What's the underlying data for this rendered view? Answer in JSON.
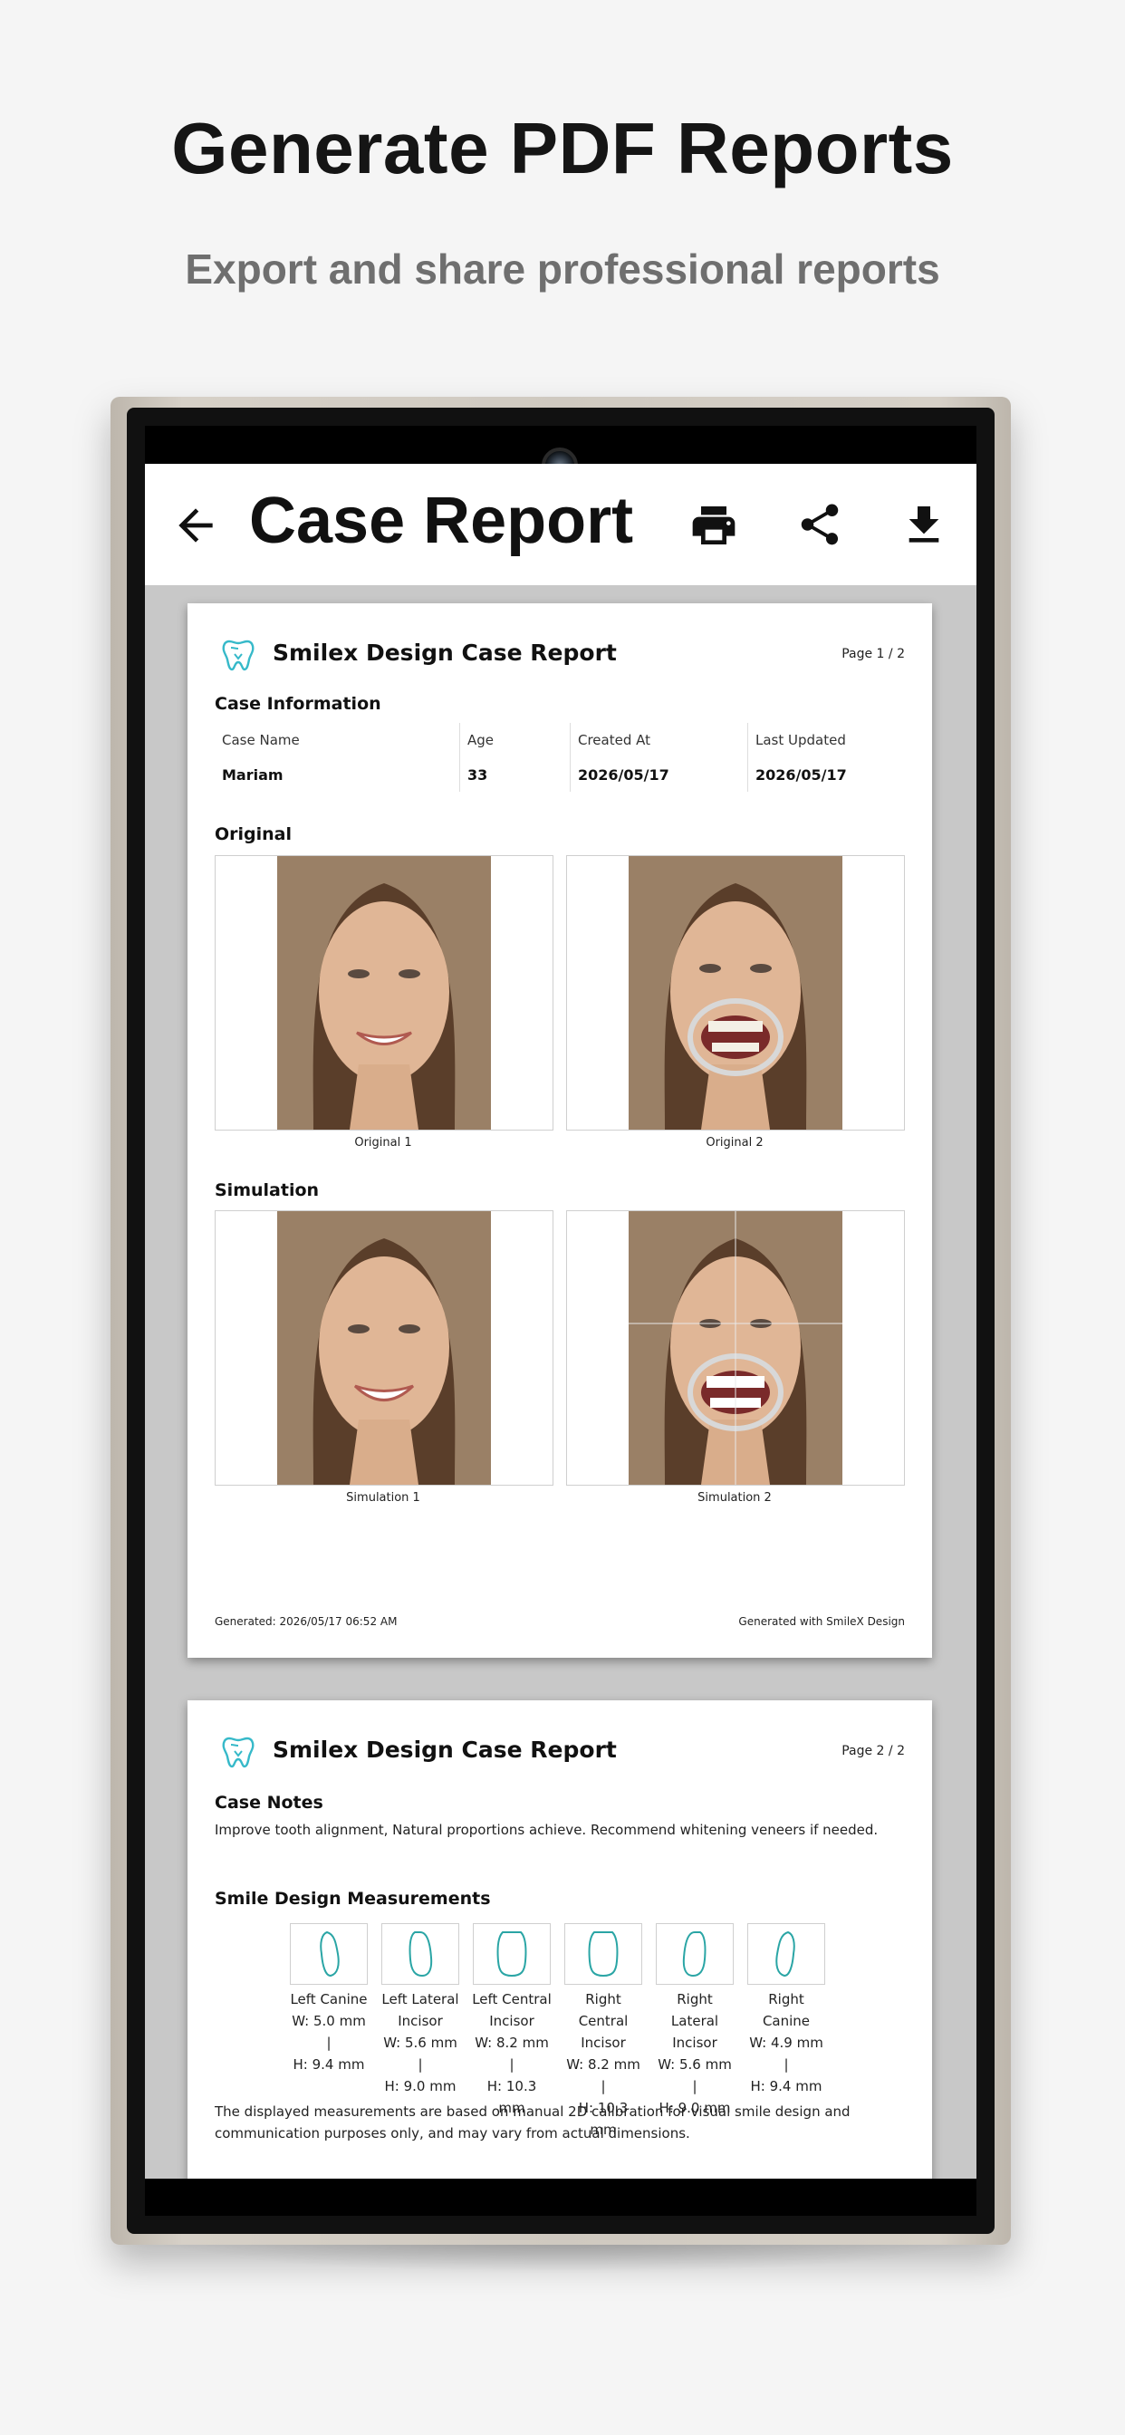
{
  "promo": {
    "headline": "Generate PDF Reports",
    "subheadline": "Export and share professional reports"
  },
  "app_bar": {
    "title": "Case Report",
    "back_icon": "arrow-left-icon",
    "actions": [
      "print-icon",
      "share-icon",
      "download-icon"
    ]
  },
  "colors": {
    "logo_accent": "#36b9c9",
    "tooth_outline": "#2aa5a5"
  },
  "page1": {
    "report_title": "Smilex Design Case Report",
    "page_label": "Page 1 / 2",
    "case_info_heading": "Case Information",
    "case_info": {
      "headers": [
        "Case Name",
        "Age",
        "Created At",
        "Last Updated"
      ],
      "values": [
        "Mariam",
        "33",
        "2026/05/17",
        "2026/05/17"
      ]
    },
    "original_heading": "Original",
    "original_captions": [
      "Original 1",
      "Original 2"
    ],
    "simulation_heading": "Simulation",
    "simulation_captions": [
      "Simulation 1",
      "Simulation 2"
    ],
    "footer_left": "Generated: 2026/05/17 06:52 AM",
    "footer_right": "Generated with SmileX Design"
  },
  "page2": {
    "report_title": "Smilex Design Case Report",
    "page_label": "Page 2 / 2",
    "notes_heading": "Case Notes",
    "notes": "Improve tooth alignment, Natural proportions achieve. Recommend whitening veneers if needed.",
    "measurements_heading": "Smile Design Measurements",
    "teeth": [
      {
        "label": "Left Canine",
        "w": "W: 5.0 mm |",
        "h": "H: 9.4 mm"
      },
      {
        "label": "Left Lateral Incisor",
        "w": "W: 5.6 mm |",
        "h": "H: 9.0 mm"
      },
      {
        "label": "Left Central Incisor",
        "w": "W: 8.2 mm |",
        "h": "H: 10.3 mm"
      },
      {
        "label": "Right Central Incisor",
        "w": "W: 8.2 mm |",
        "h": "H: 10.3 mm"
      },
      {
        "label": "Right Lateral Incisor",
        "w": "W: 5.6 mm |",
        "h": "H: 9.0 mm"
      },
      {
        "label": "Right Canine",
        "w": "W: 4.9 mm |",
        "h": "H: 9.4 mm"
      }
    ],
    "disclaimer": "The displayed measurements are based on manual 2D calibration for visual smile design and communication purposes only, and may vary from actual dimensions."
  }
}
